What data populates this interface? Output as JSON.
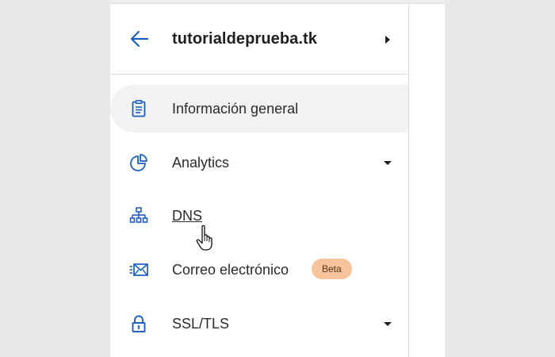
{
  "header": {
    "site_title": "tutorialdeprueba.tk",
    "back_icon": "arrow-left-icon",
    "menu_icon": "caret-right-icon"
  },
  "nav": {
    "items": [
      {
        "label": "Información general",
        "icon": "clipboard-icon",
        "active": true
      },
      {
        "label": "Analytics",
        "icon": "pie-chart-icon",
        "expandable": true
      },
      {
        "label": "DNS",
        "icon": "network-tree-icon",
        "hovered": true
      },
      {
        "label": "Correo electrónico",
        "icon": "mail-forward-icon",
        "badge": "Beta"
      },
      {
        "label": "SSL/TLS",
        "icon": "lock-icon",
        "expandable": true
      }
    ]
  },
  "colors": {
    "accent": "#1f5fbf",
    "active_background": "#f2f2f2",
    "badge_background": "#f7c39a",
    "page_background": "#e7e8ea"
  }
}
